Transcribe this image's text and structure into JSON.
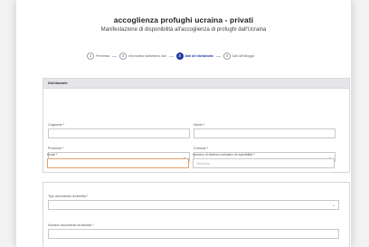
{
  "header": {
    "title": "accoglienza profughi ucraina - privati",
    "subtitle": "Manifestazione di disponibilità all'accoglienza di profughi dall'Ucraina"
  },
  "steps": [
    {
      "num": "1",
      "label": "Premessa",
      "active": false
    },
    {
      "num": "2",
      "label": "Informativa trattamento dati",
      "active": false
    },
    {
      "num": "3",
      "label": "Dati del dichiarante",
      "active": true
    },
    {
      "num": "4",
      "label": "Dati dell'alloggio",
      "active": false
    }
  ],
  "section": {
    "title": "Dichiarante",
    "fields": {
      "cognome": {
        "label": "Cognome",
        "req": "*"
      },
      "nome": {
        "label": "Nome",
        "req": "*"
      },
      "provincia": {
        "label": "Provincia",
        "req": "*"
      },
      "comune": {
        "label": "Comune",
        "req": "*"
      },
      "email": {
        "label": "Email",
        "req": "*"
      },
      "telefono": {
        "label": "Numero di telefono cellulare di reperibilità",
        "req": "*",
        "placeholder": "Telefono"
      }
    }
  },
  "section2": {
    "fields": {
      "tipo_documento": {
        "label": "Tipo documento di identità",
        "req": "*"
      },
      "numero_documento": {
        "label": "Numero documento di identità",
        "req": "*"
      }
    }
  },
  "icons": {
    "select_chevron": "chevron-down-icon"
  },
  "colors": {
    "accent": "#1e3aa0",
    "error_border": "#e8a36a",
    "header_bg": "#e6e6ea"
  }
}
